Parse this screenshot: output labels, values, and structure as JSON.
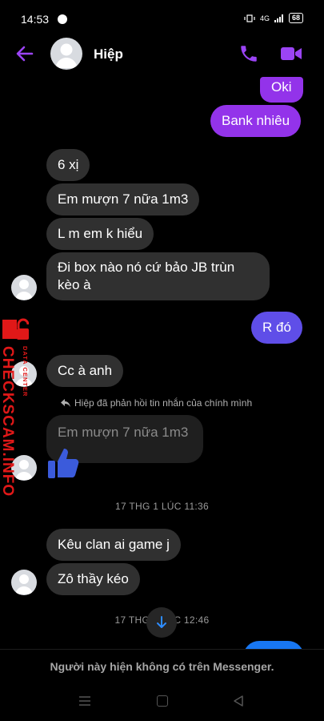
{
  "status_bar": {
    "time": "14:53",
    "network": "4G",
    "battery": "68"
  },
  "header": {
    "contact_name": "Hiệp"
  },
  "messages": [
    {
      "text": "Oki"
    },
    {
      "text": "Bank nhiêu"
    },
    {
      "text": "6 xị"
    },
    {
      "text": "Em mượn 7 nữa 1m3"
    },
    {
      "text": "L m em  k hiểu"
    },
    {
      "text": "Đi box nào nó cứ bảo JB trùn kèo à"
    },
    {
      "text": "R đó"
    },
    {
      "text": "Cc à anh"
    },
    {
      "text": "Kêu clan ai game j"
    },
    {
      "text": "Zô thầy kéo"
    }
  ],
  "reply": {
    "note": "Hiệp đã phản hồi tin nhắn của chính mình",
    "quoted_text": "Em mượn 7 nữa 1m3"
  },
  "timestamps": {
    "t1": "17 THG 1 LÚC 11:36",
    "t2": "17 THG 1 LÚC 12:46"
  },
  "footer": {
    "notice": "Người này hiện không có trên Messenger."
  },
  "watermark": {
    "sub": "DATA CENTER",
    "main": "CHECKSCAM.INFO"
  },
  "colors": {
    "accent": "#9333ea",
    "incoming_bubble": "#303030",
    "like": "#3b5bdb",
    "watermark": "#e01818"
  }
}
